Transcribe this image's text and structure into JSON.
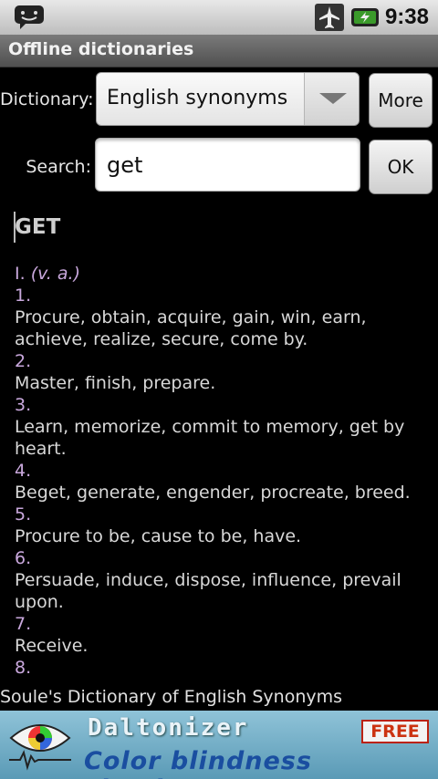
{
  "status_bar": {
    "time": "9:38"
  },
  "title_bar": {
    "title": "Offline dictionaries"
  },
  "form": {
    "dictionary_label": "Dictionary:",
    "dictionary_selected": "English synonyms",
    "more_button": "More",
    "search_label": "Search:",
    "search_value": "get",
    "ok_button": "OK"
  },
  "result": {
    "headword": "GET",
    "roman": "I.",
    "part_of_speech": "(v. a.)",
    "senses": [
      {
        "num": "1.",
        "text": "Procure, obtain, acquire, gain, win, earn, achieve, realize, secure, come by."
      },
      {
        "num": "2.",
        "text": "Master, finish, prepare."
      },
      {
        "num": "3.",
        "text": "Learn, memorize, commit to memory, get by heart."
      },
      {
        "num": "4.",
        "text": "Beget, generate, engender, procreate, breed."
      },
      {
        "num": "5.",
        "text": "Procure to be, cause to be, have."
      },
      {
        "num": "6.",
        "text": "Persuade, induce, dispose, influence, prevail upon."
      },
      {
        "num": "7.",
        "text": "Receive."
      },
      {
        "num": "8.",
        "text": ""
      }
    ]
  },
  "source_line": "Soule's Dictionary of English Synonyms",
  "ad": {
    "title": "Daltonizer",
    "badge": "FREE",
    "subtitle": "Color blindness simulator"
  },
  "icons": {
    "status_left": "chat-bubble-icon",
    "airplane": "airplane-mode-icon",
    "battery": "battery-charging-icon",
    "spinner_arrow": "chevron-down-icon",
    "ad_eye": "eye-icon"
  }
}
